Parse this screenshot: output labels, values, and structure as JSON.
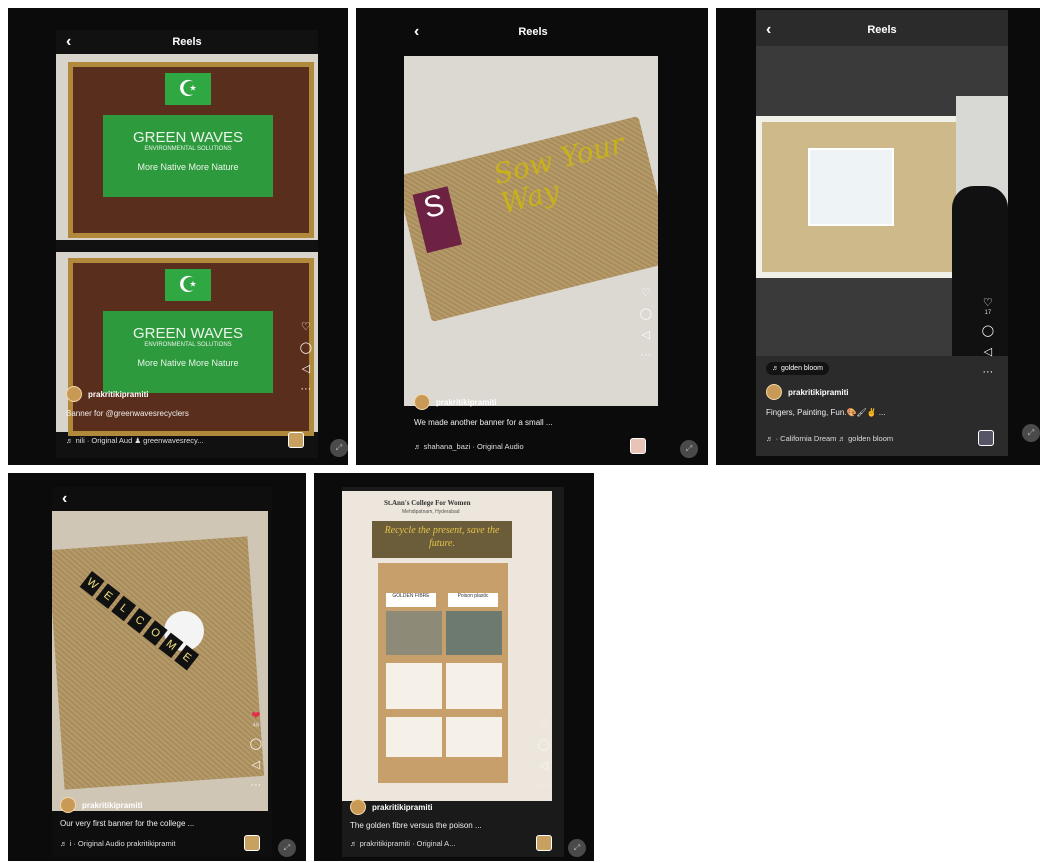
{
  "reels": [
    {
      "header": "Reels",
      "username": "prakritikipramiti",
      "caption": "Banner for @greenwavesrecyclers",
      "audio": "♬ nili · Original Aud  ♟ greenwavesrecy...",
      "banner_line1": "GREEN WAVES",
      "banner_line2": "ENVIRONMENTAL SOLUTIONS",
      "banner_line3": "More Native More Nature"
    },
    {
      "header": "Reels",
      "username": "prakritikipramiti",
      "caption": "We made another banner for a small ...",
      "audio": "♬ shahana_bazi · Original Audio",
      "likes": "",
      "banner_text": "Sow Your Way"
    },
    {
      "header": "Reels",
      "username": "prakritikipramiti",
      "caption": "Fingers, Painting, Fun.🎨🖌✌ ...",
      "audio": "♬ · California Dream  ♬ golden bloom",
      "likes": "17",
      "tag": "♬ golden bloom"
    },
    {
      "header": "",
      "username": "prakritikipramiti",
      "caption": "Our very first banner for the college ...",
      "audio": "♬ i · Original Audio prakritikipramit",
      "likes": "46",
      "banner_letters": [
        "W",
        "E",
        "L",
        "C",
        "O",
        "M",
        "E"
      ]
    },
    {
      "header": "",
      "username": "prakritikipramiti",
      "caption": "The golden fibre versus the poison ...",
      "audio": "♬ prakritikipramiti · Original A...",
      "poster_title": "St.Ann's College For Women",
      "poster_sub": "Mehdipatnam, Hyderabad",
      "poster_slogan": "Recycle the present, save the future.",
      "col1": "GOLDEN FIBRE",
      "col2": "Poison plastic"
    }
  ],
  "icons": {
    "heart": "♡",
    "heart_filled": "❤",
    "comment": "◯",
    "share": "◁",
    "more": "···",
    "back": "‹",
    "expand": "⤢"
  }
}
